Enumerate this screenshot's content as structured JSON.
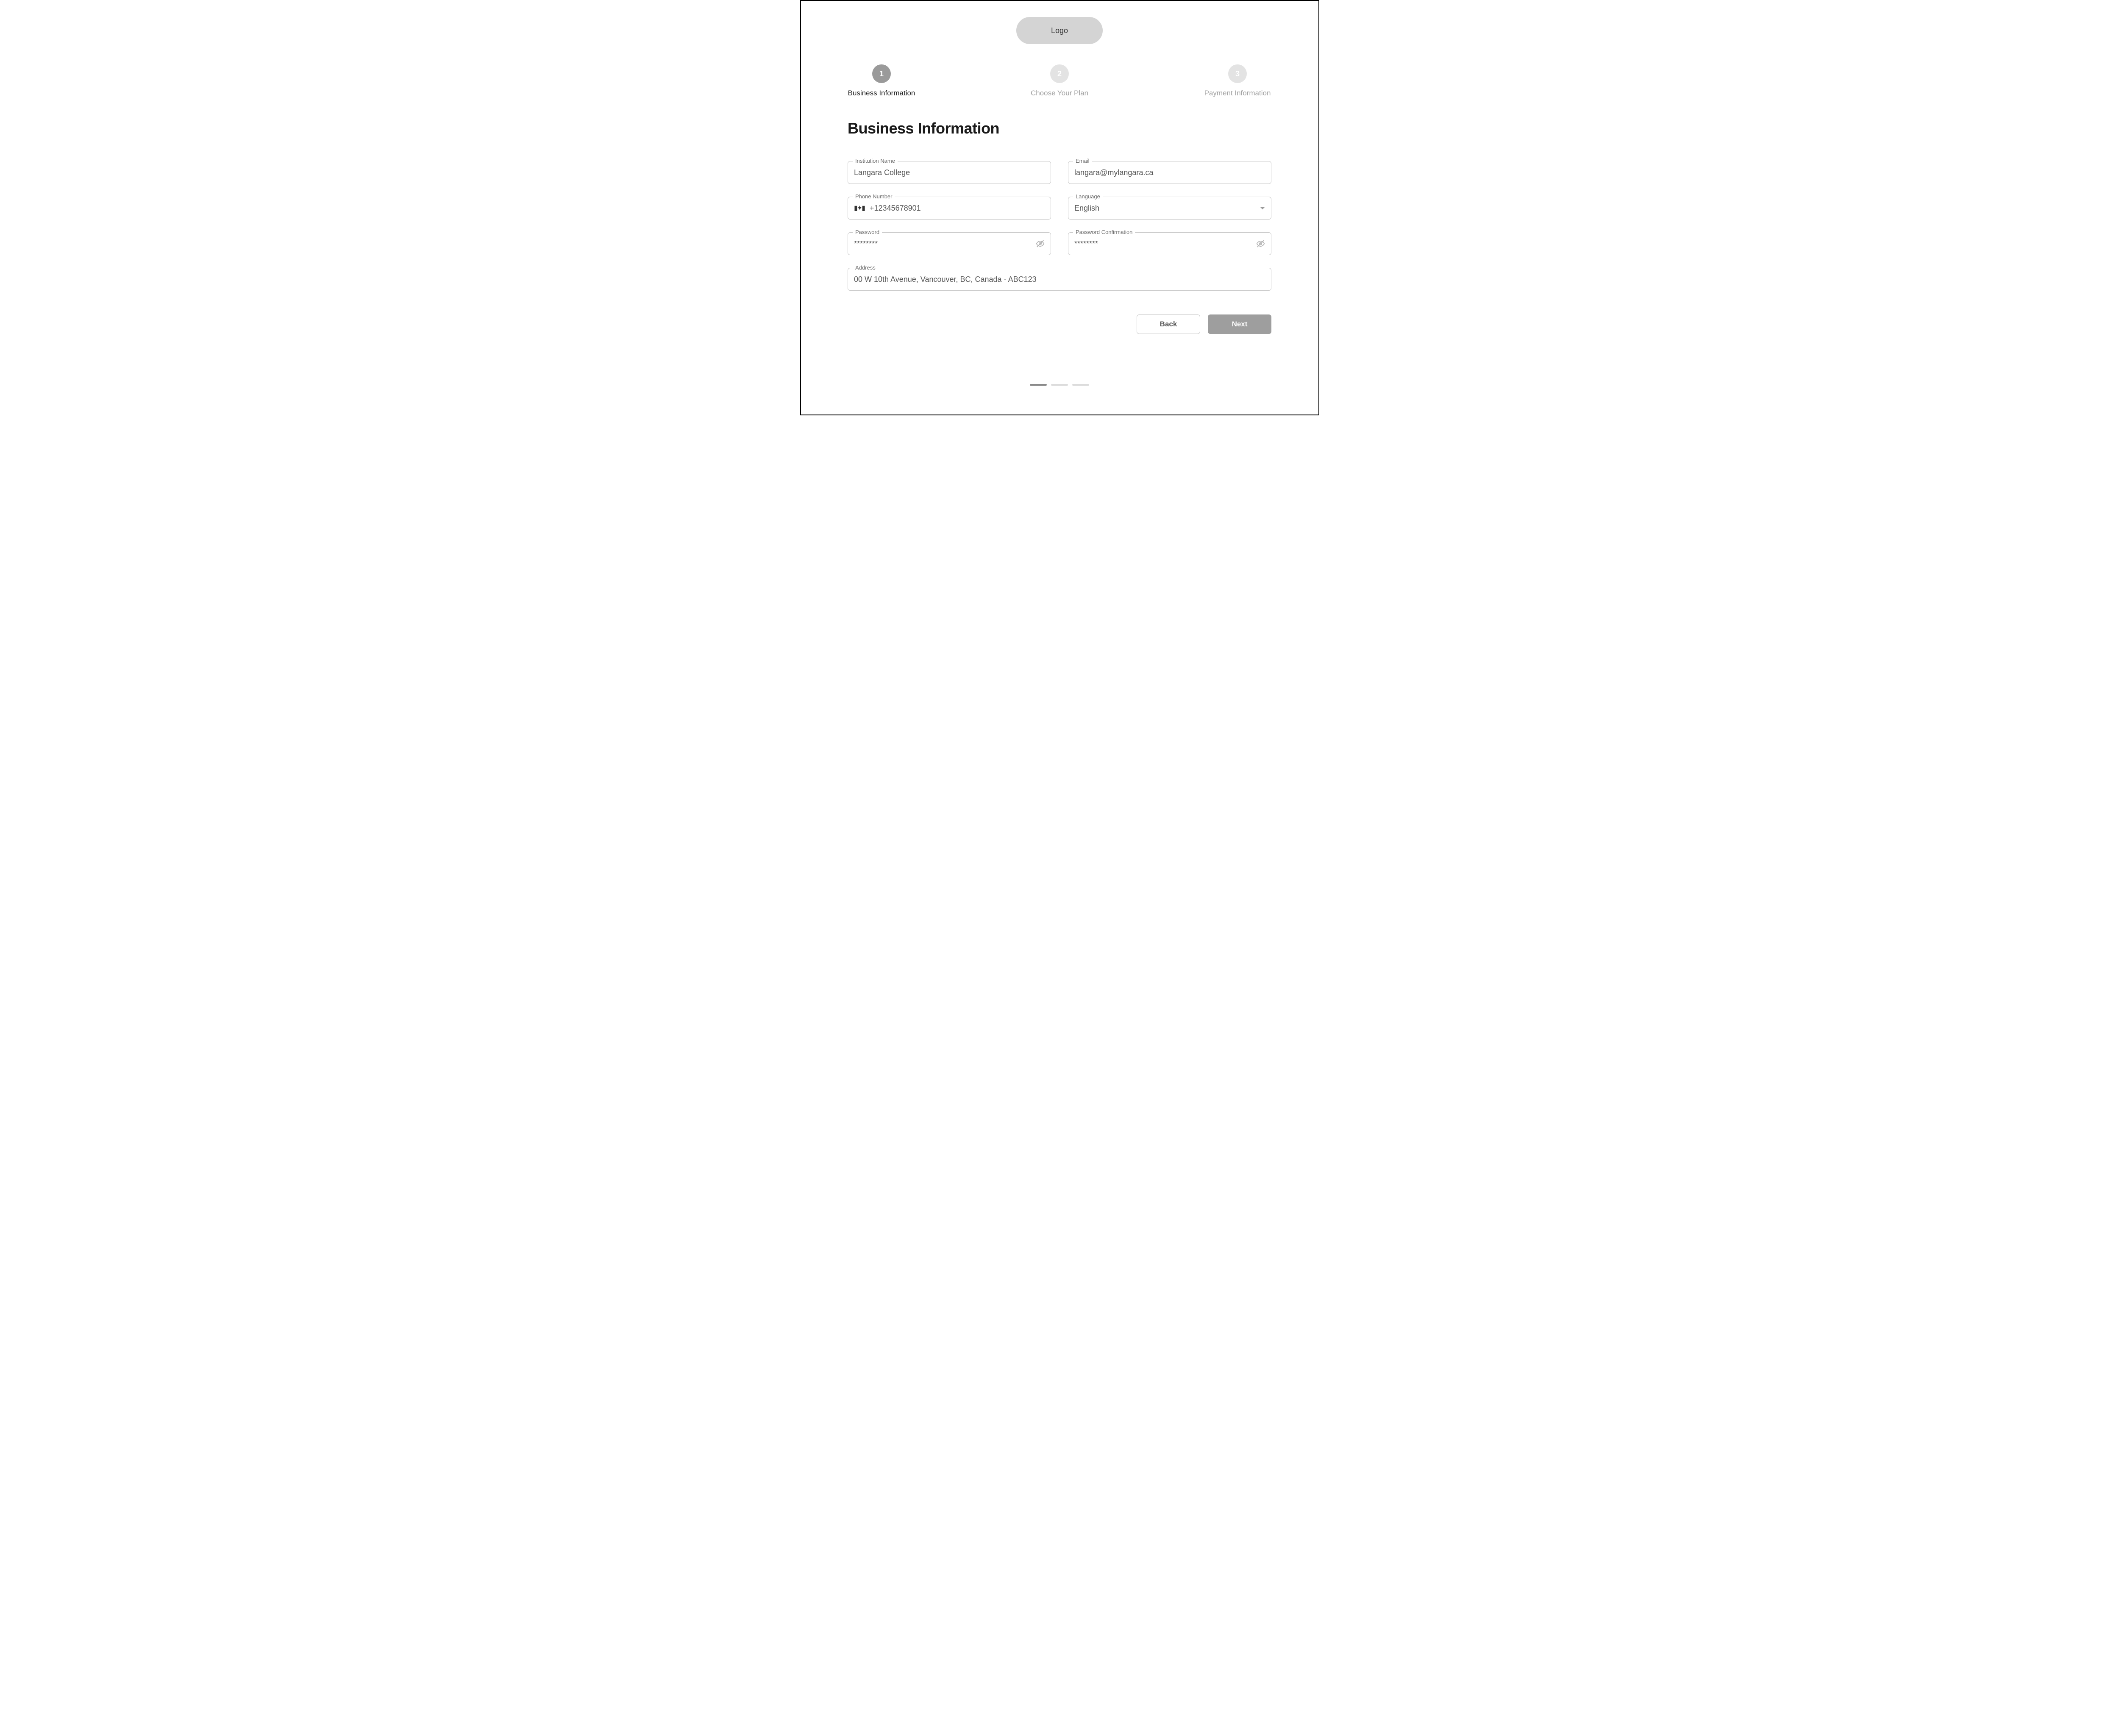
{
  "header": {
    "logo_label": "Logo"
  },
  "stepper": {
    "steps": [
      {
        "num": "1",
        "label": "Business Information",
        "active": true
      },
      {
        "num": "2",
        "label": "Choose Your Plan",
        "active": false
      },
      {
        "num": "3",
        "label": "Payment Information",
        "active": false
      }
    ]
  },
  "page": {
    "title": "Business Information"
  },
  "form": {
    "institution": {
      "label": "Institution Name",
      "value": "Langara College"
    },
    "email": {
      "label": "Email",
      "value": "langara@mylangara.ca"
    },
    "phone": {
      "label": "Phone Number",
      "value": "+12345678901",
      "flag": "canada"
    },
    "language": {
      "label": "Language",
      "value": "English"
    },
    "password": {
      "label": "Password",
      "value": "********"
    },
    "password2": {
      "label": "Password Confirmation",
      "value": "********"
    },
    "address": {
      "label": "Address",
      "value": "00 W 10th Avenue, Vancouver, BC, Canada - ABC123"
    }
  },
  "actions": {
    "back": "Back",
    "next": "Next"
  },
  "pager": {
    "total": 3,
    "current": 1
  }
}
